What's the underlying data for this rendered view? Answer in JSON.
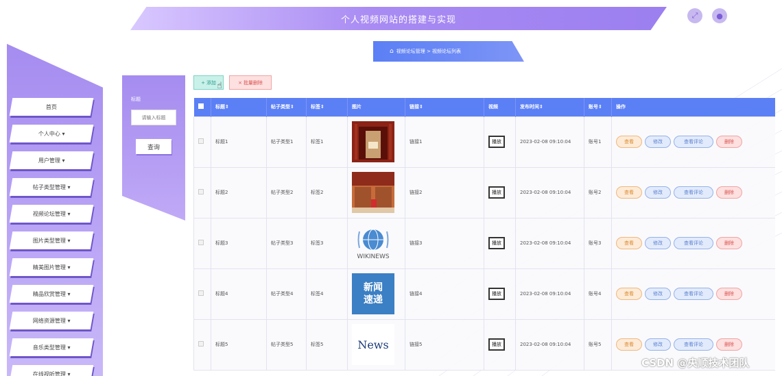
{
  "header": {
    "title": "个人视频网站的搭建与实现"
  },
  "sidebar": {
    "items": [
      {
        "label": "首页"
      },
      {
        "label": "个人中心 ▾"
      },
      {
        "label": "用户管理 ▾"
      },
      {
        "label": "帖子类型管理 ▾"
      },
      {
        "label": "视频论坛管理 ▾"
      },
      {
        "label": "图片类型管理 ▾"
      },
      {
        "label": "精美图片管理 ▾"
      },
      {
        "label": "精品欣赏管理 ▾"
      },
      {
        "label": "网络资源管理 ▾"
      },
      {
        "label": "音乐类型管理 ▾"
      },
      {
        "label": "在线视听管理 ▾"
      }
    ]
  },
  "search": {
    "label": "标题",
    "placeholder": "请输入标题",
    "button": "查询"
  },
  "breadcrumb": {
    "text": "视频论坛管理 > 视频论坛列表"
  },
  "actions": {
    "add": "添加",
    "batch_delete": "批量删除"
  },
  "table": {
    "headers": [
      "标题⇕",
      "帖子类型⇕",
      "标签⇕",
      "图片",
      "链接⇕",
      "视频",
      "发布时间⇕",
      "账号⇕",
      "操作"
    ],
    "rows": [
      {
        "title": "标题1",
        "type": "帖子类型1",
        "tag": "标签1",
        "image": "photo-red-hall",
        "link": "链接1",
        "video": "播放",
        "time": "2023-02-08 09:10:04",
        "account": "账号1"
      },
      {
        "title": "标题2",
        "type": "帖子类型2",
        "tag": "标签2",
        "image": "photo-library",
        "link": "链接2",
        "video": "播放",
        "time": "2023-02-08 09:10:04",
        "account": "账号2"
      },
      {
        "title": "标题3",
        "type": "帖子类型3",
        "tag": "标签3",
        "image": "WIKINEWS",
        "link": "链接3",
        "video": "播放",
        "time": "2023-02-08 09:10:04",
        "account": "账号3"
      },
      {
        "title": "标题4",
        "type": "帖子类型4",
        "tag": "标签4",
        "image": "新闻速递",
        "link": "链接4",
        "video": "播放",
        "time": "2023-02-08 09:10:04",
        "account": "账号4"
      },
      {
        "title": "标题5",
        "type": "帖子类型5",
        "tag": "标签5",
        "image": "News",
        "link": "链接5",
        "video": "播放",
        "time": "2023-02-08 09:10:04",
        "account": "账号5"
      }
    ],
    "ops": {
      "view": "查看",
      "edit": "修改",
      "comment": "查看评论",
      "delete": "删除"
    }
  },
  "watermark": "CSDN @央顺技术团队"
}
